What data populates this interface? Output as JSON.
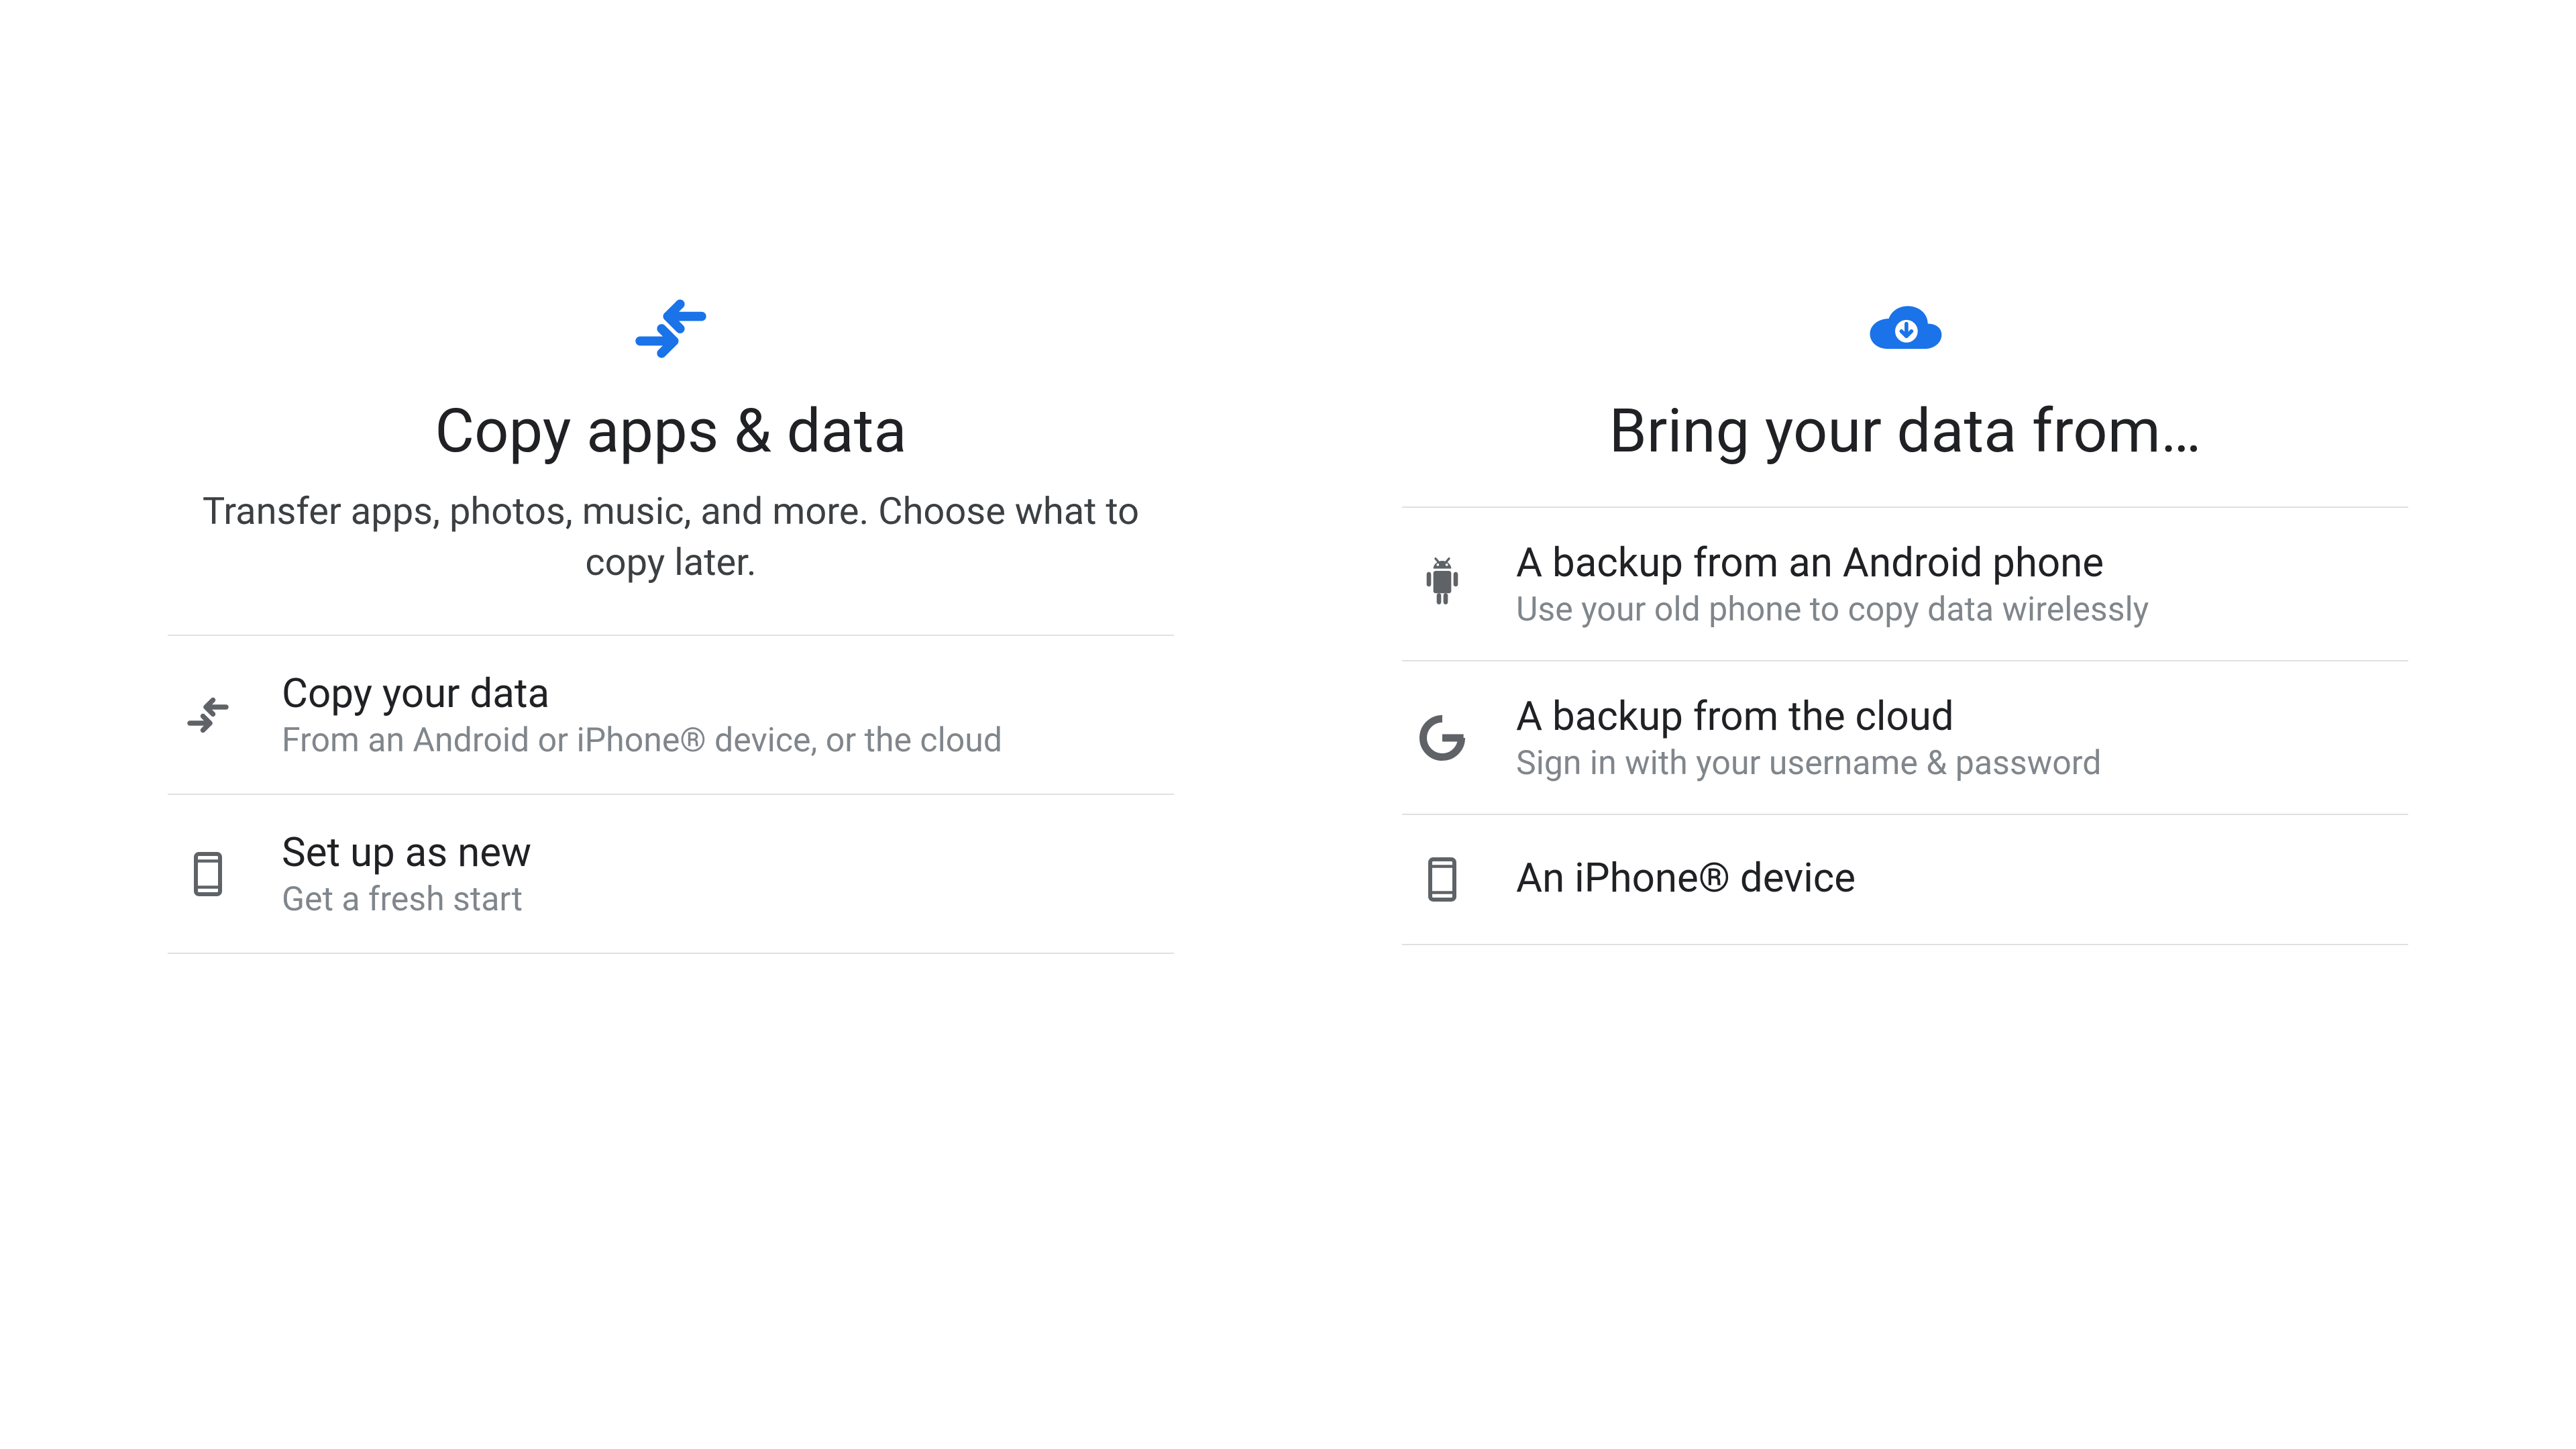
{
  "colors": {
    "accent": "#1a73e8",
    "text_primary": "#202124",
    "text_secondary": "#80868b",
    "divider": "#e0e0e0",
    "icon_muted": "#5f6368"
  },
  "panel_a": {
    "icon": "arrows-swap-icon",
    "title": "Copy apps & data",
    "subtitle": "Transfer apps, photos, music, and more. Choose what to copy later.",
    "options": [
      {
        "icon": "arrows-swap-icon",
        "title": "Copy your data",
        "subtitle": "From an Android or iPhone® device, or the cloud"
      },
      {
        "icon": "phone-outline-icon",
        "title": "Set up as new",
        "subtitle": "Get a fresh start"
      }
    ]
  },
  "panel_b": {
    "icon": "cloud-download-icon",
    "title": "Bring your data from…",
    "options": [
      {
        "icon": "android-icon",
        "title": "A backup from an Android phone",
        "subtitle": "Use your old phone to copy data wirelessly"
      },
      {
        "icon": "google-g-icon",
        "title": "A backup from the cloud",
        "subtitle": "Sign in with your username & password"
      },
      {
        "icon": "phone-outline-icon",
        "title": "An iPhone® device",
        "subtitle": ""
      }
    ]
  }
}
